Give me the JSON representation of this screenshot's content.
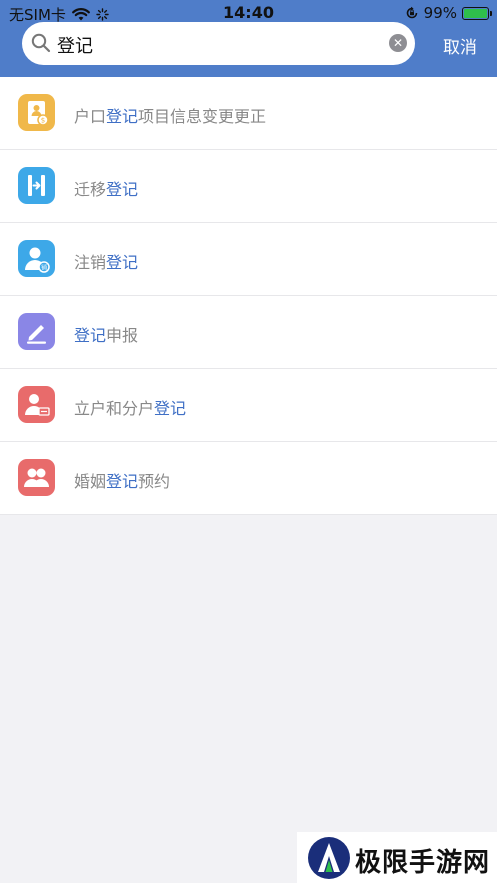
{
  "status_bar": {
    "carrier": "无SIM卡",
    "time": "14:40",
    "battery": "99%",
    "battery_level": 0.99
  },
  "search": {
    "query": "登记",
    "cancel_label": "取消"
  },
  "results": [
    {
      "prefix": "户口",
      "match": "登记",
      "suffix": "项目信息变更更正",
      "icon": "household-register-icon",
      "color": "#f0b84a"
    },
    {
      "prefix": "迁移",
      "match": "登记",
      "suffix": "",
      "icon": "migration-icon",
      "color": "#3da8e8"
    },
    {
      "prefix": "注销",
      "match": "登记",
      "suffix": "",
      "icon": "cancel-registration-icon",
      "color": "#3da8e8"
    },
    {
      "prefix": "",
      "match": "登记",
      "suffix": "申报",
      "icon": "pencil-icon",
      "color": "#8a86e6"
    },
    {
      "prefix": "立户和分户",
      "match": "登记",
      "suffix": "",
      "icon": "household-split-icon",
      "color": "#e86b6b"
    },
    {
      "prefix": "婚姻",
      "match": "登记",
      "suffix": "预约",
      "icon": "marriage-icon",
      "color": "#e86b6b"
    }
  ],
  "watermark": {
    "text": "极限手游网"
  }
}
